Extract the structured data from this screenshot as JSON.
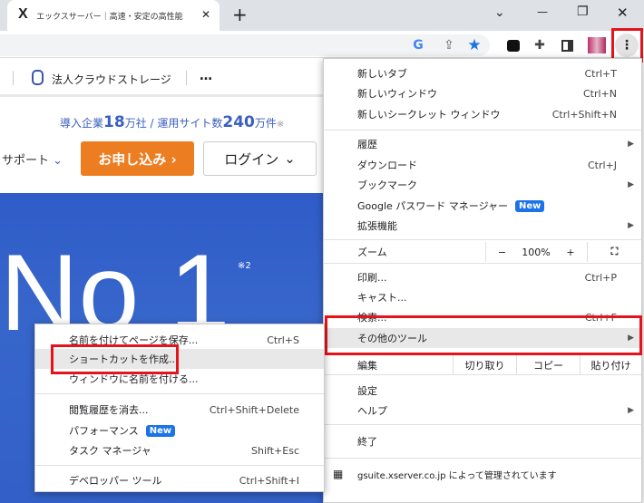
{
  "tab": {
    "title": "エックスサーバー｜高速・安定の高性能",
    "close": "✕",
    "new_tab": "+"
  },
  "window": {
    "dropdown": "⌄",
    "minimize": "—",
    "restore": "❐",
    "close": "✕"
  },
  "page": {
    "nav_item": "法人クラウドストレージ",
    "nav_more": "…",
    "stats": {
      "prefix": "導入企業",
      "num1": "18",
      "unit1": "万社 / 運用サイト数",
      "num2": "240",
      "unit2": "万件",
      "note": "※"
    },
    "support": "サポート",
    "apply": "お申し込み ›",
    "login": "ログイン",
    "hero_text": "No 1",
    "hero_note": "※2"
  },
  "menu": {
    "items": [
      {
        "label": "新しいタブ",
        "shortcut": "Ctrl+T"
      },
      {
        "label": "新しいウィンドウ",
        "shortcut": "Ctrl+N"
      },
      {
        "label": "新しいシークレット ウィンドウ",
        "shortcut": "Ctrl+Shift+N"
      },
      {
        "label": "履歴"
      },
      {
        "label": "ダウンロード",
        "shortcut": "Ctrl+J"
      },
      {
        "label": "ブックマーク"
      },
      {
        "label": "Google パスワード マネージャー",
        "badge": "New"
      },
      {
        "label": "拡張機能"
      },
      {
        "label": "印刷...",
        "shortcut": "Ctrl+P"
      },
      {
        "label": "キャスト..."
      },
      {
        "label": "検索...",
        "shortcut": "Ctrl+F"
      },
      {
        "label": "その他のツール"
      },
      {
        "label": "設定"
      },
      {
        "label": "ヘルプ"
      },
      {
        "label": "終了"
      }
    ],
    "zoom": {
      "label": "ズーム",
      "minus": "−",
      "value": "100%",
      "plus": "+"
    },
    "edit": {
      "label": "編集",
      "cut": "切り取り",
      "copy": "コピー",
      "paste": "貼り付け"
    },
    "managed": "gsuite.xserver.co.jp によって管理されています"
  },
  "submenu": {
    "items": [
      {
        "label": "名前を付けてページを保存...",
        "shortcut": "Ctrl+S"
      },
      {
        "label": "ショートカットを作成..."
      },
      {
        "label": "ウィンドウに名前を付ける..."
      },
      {
        "label": "閲覧履歴を消去...",
        "shortcut": "Ctrl+Shift+Delete"
      },
      {
        "label": "パフォーマンス",
        "badge": "New"
      },
      {
        "label": "タスク マネージャ",
        "shortcut": "Shift+Esc"
      },
      {
        "label": "デベロッパー ツール",
        "shortcut": "Ctrl+Shift+I"
      }
    ]
  },
  "colors": {
    "accent": "#1a73e8",
    "highlight": "#e4141b",
    "apply": "#ed7d21",
    "hero": "#3463c9",
    "stats": "#3b5fc0"
  }
}
